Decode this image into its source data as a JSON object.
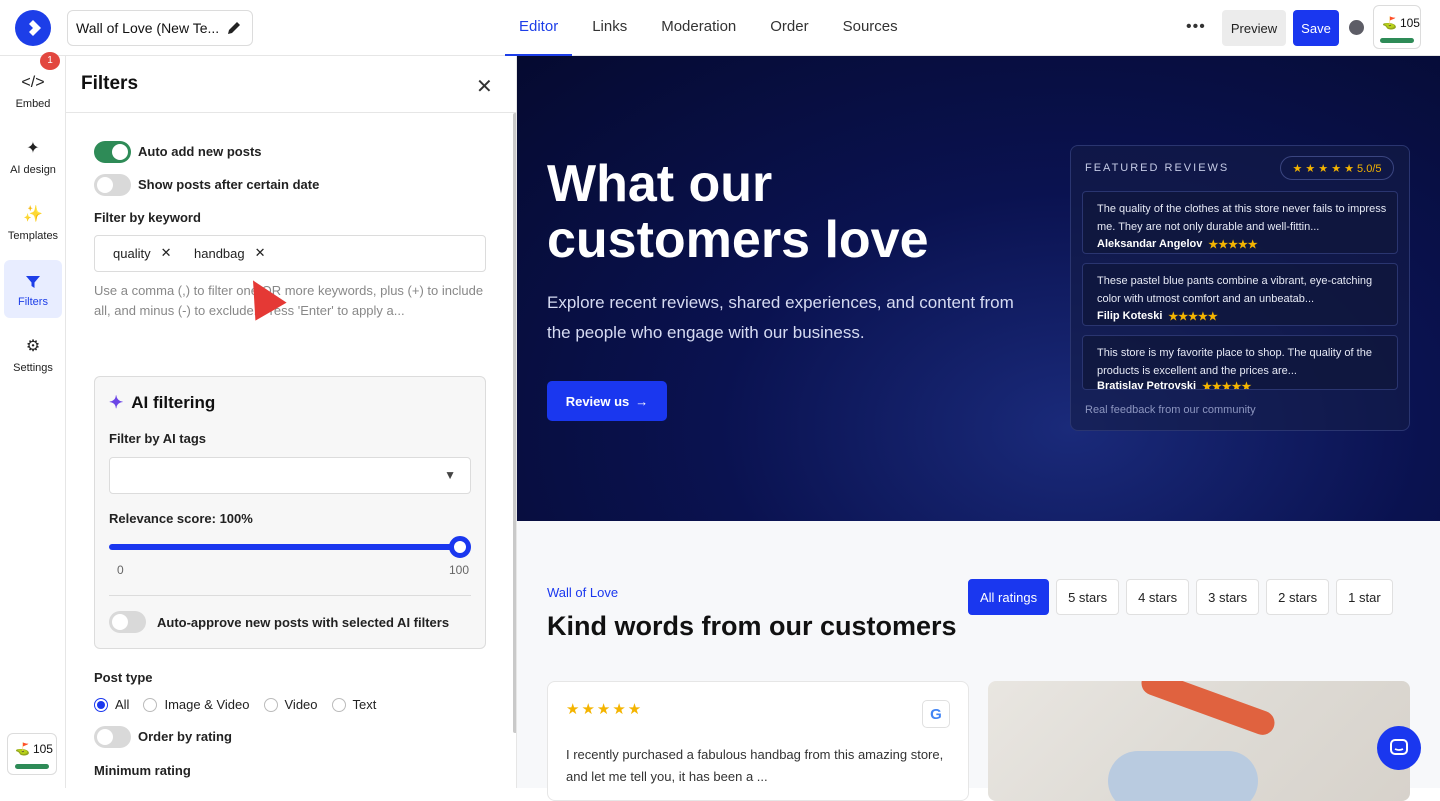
{
  "topbar": {
    "title": "Wall of Love (New Te...",
    "tabs": [
      {
        "label": "Editor",
        "active": true
      },
      {
        "label": "Links"
      },
      {
        "label": "Moderation"
      },
      {
        "label": "Order"
      },
      {
        "label": "Sources"
      }
    ],
    "more": "•••",
    "preview_label": "Preview",
    "save_label": "Save",
    "credits": "105",
    "accent": "#1a37ef"
  },
  "sidebar": {
    "badge": "1",
    "items": [
      {
        "label": "Embed",
        "icon": "code-icon"
      },
      {
        "label": "AI design",
        "icon": "sparkle-icon"
      },
      {
        "label": "Templates",
        "icon": "sparkles-icon"
      },
      {
        "label": "Filters",
        "icon": "filter-icon",
        "active": true
      },
      {
        "label": "Settings",
        "icon": "gear-icon"
      }
    ],
    "credits": "105"
  },
  "filters": {
    "title": "Filters",
    "auto_add": "Auto add new posts",
    "show_after_date": "Show posts after certain date",
    "keyword_label": "Filter by keyword",
    "keywords": [
      "quality",
      "handbag"
    ],
    "help": "Use a comma (,) to filter one OR more keywords, plus (+) to include all, and minus (-) to exclude. Press 'Enter' to apply a...",
    "ai": {
      "title": "AI filtering",
      "tags_label": "Filter by AI tags",
      "relevance_label": "Relevance score: 100%",
      "relevance_value": 100,
      "min": "0",
      "max": "100",
      "auto_approve": "Auto-approve new posts with selected AI filters"
    },
    "post_type_label": "Post type",
    "post_types": [
      "All",
      "Image & Video",
      "Video",
      "Text"
    ],
    "selected_post_type": "All",
    "order_by_rating": "Order by rating",
    "min_rating_label": "Minimum rating"
  },
  "hero": {
    "title": "What our customers love",
    "subtitle": "Explore recent reviews, shared experiences, and content from the people who engage with our business.",
    "cta": "Review us",
    "featured": {
      "header": "FEATURED REVIEWS",
      "score": "★ ★ ★ ★ ★  5.0/5",
      "reviews": [
        {
          "text": "The quality of the clothes at this store never fails to impress me. They are not only durable and well-fittin...",
          "author": "Aleksandar Angelov",
          "stars": "★★★★★"
        },
        {
          "text": "These pastel blue pants combine a vibrant, eye-catching color with utmost comfort and an unbeatab...",
          "author": "Filip Koteski",
          "stars": "★★★★★"
        },
        {
          "text": "This store is my favorite place to shop. The quality of the products is excellent and the prices are...",
          "author": "Bratislav Petrovski",
          "stars": "★★★★★"
        }
      ],
      "footer": "Real feedback from our community"
    }
  },
  "wall": {
    "kicker": "Wall of Love",
    "title": "Kind words from our customers",
    "rating_filters": [
      "All ratings",
      "5 stars",
      "4 stars",
      "3 stars",
      "2 stars",
      "1 star"
    ],
    "card": {
      "stars": "★★★★★",
      "source": "G",
      "text": "I recently purchased a fabulous handbag from this amazing store, and let me tell you, it has been a ..."
    }
  }
}
